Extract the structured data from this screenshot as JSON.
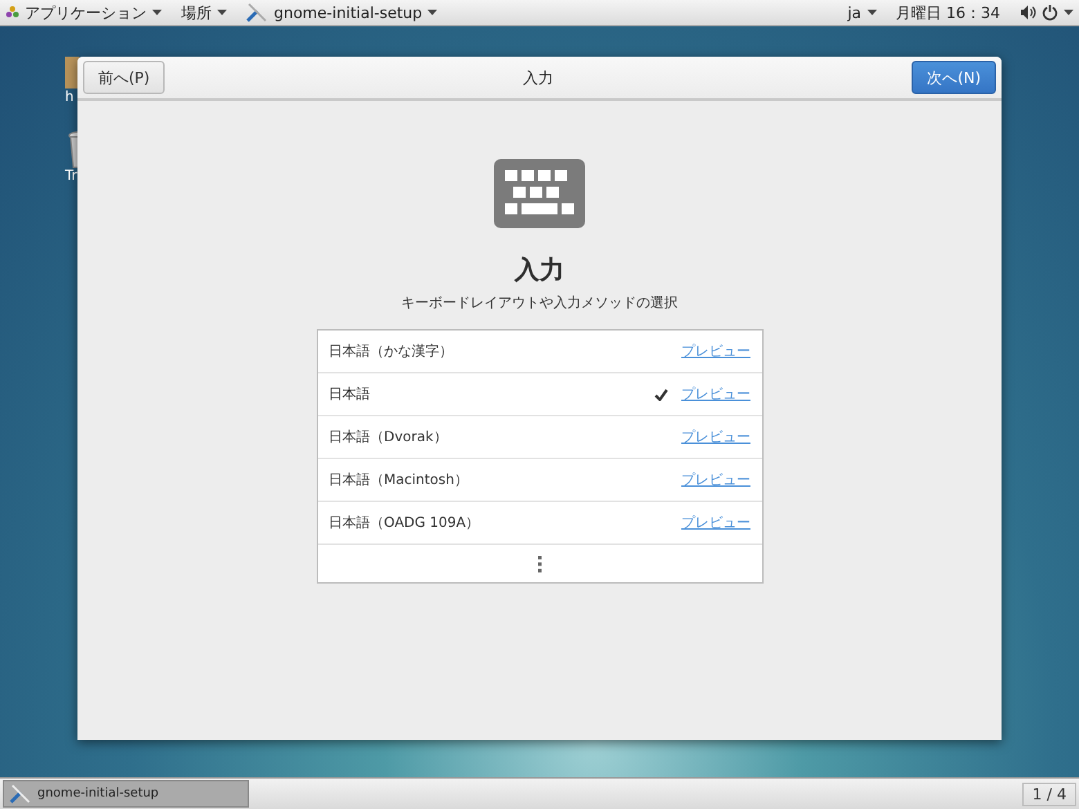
{
  "top_bar": {
    "apps_menu": "アプリケーション",
    "places_menu": "場所",
    "app_menu": "gnome-initial-setup",
    "input_method": "ja",
    "clock": "月曜日 16：34"
  },
  "desktop_icons": [
    {
      "label": "h",
      "kind": "folder"
    },
    {
      "label": "Tr",
      "kind": "trash"
    }
  ],
  "window": {
    "title": "入力",
    "back_button": "前へ(P)",
    "next_button": "次へ(N)",
    "heading": "入力",
    "subtitle": "キーボードレイアウトや入力メソッドの選択",
    "layouts": [
      {
        "name": "日本語（かな漢字）",
        "selected": false,
        "preview": "プレビュー"
      },
      {
        "name": "日本語",
        "selected": true,
        "preview": "プレビュー"
      },
      {
        "name": "日本語（Dvorak）",
        "selected": false,
        "preview": "プレビュー"
      },
      {
        "name": "日本語（Macintosh）",
        "selected": false,
        "preview": "プレビュー"
      },
      {
        "name": "日本語（OADG 109A）",
        "selected": false,
        "preview": "プレビュー"
      }
    ]
  },
  "taskbar": {
    "task": "gnome-initial-setup",
    "workspace": "1 / 4"
  }
}
